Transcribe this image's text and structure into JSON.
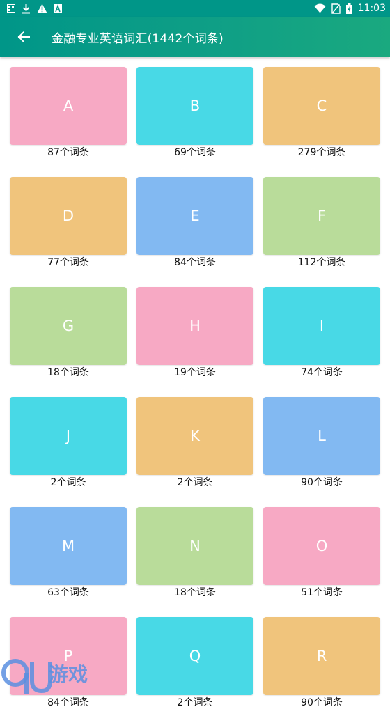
{
  "status_bar": {
    "time": "11:03",
    "left_icons": [
      "gallery-icon",
      "download-icon",
      "warning-icon",
      "a-box-icon"
    ],
    "right_icons": [
      "wifi-icon",
      "no-sim-icon",
      "battery-icon"
    ]
  },
  "header": {
    "title": "金融专业英语词汇(1442个词条)",
    "back_icon": "arrow-left-icon",
    "background": "#009688"
  },
  "palette": {
    "pink": "#F7A9C4",
    "cyan": "#48D9E6",
    "orange": "#F0C47C",
    "blue": "#82B9F2",
    "green": "#B9DC9A"
  },
  "tiles": [
    {
      "letter": "A",
      "count": "87个词条",
      "color": "#F7A9C4"
    },
    {
      "letter": "B",
      "count": "69个词条",
      "color": "#48D9E6"
    },
    {
      "letter": "C",
      "count": "279个词条",
      "color": "#F0C47C"
    },
    {
      "letter": "D",
      "count": "77个词条",
      "color": "#F0C47C"
    },
    {
      "letter": "E",
      "count": "84个词条",
      "color": "#82B9F2"
    },
    {
      "letter": "F",
      "count": "112个词条",
      "color": "#B9DC9A"
    },
    {
      "letter": "G",
      "count": "18个词条",
      "color": "#B9DC9A"
    },
    {
      "letter": "H",
      "count": "19个词条",
      "color": "#F7A9C4"
    },
    {
      "letter": "I",
      "count": "74个词条",
      "color": "#48D9E6"
    },
    {
      "letter": "J",
      "count": "2个词条",
      "color": "#48D9E6"
    },
    {
      "letter": "K",
      "count": "2个词条",
      "color": "#F0C47C"
    },
    {
      "letter": "L",
      "count": "90个词条",
      "color": "#82B9F2"
    },
    {
      "letter": "M",
      "count": "63个词条",
      "color": "#82B9F2"
    },
    {
      "letter": "N",
      "count": "18个词条",
      "color": "#B9DC9A"
    },
    {
      "letter": "O",
      "count": "51个词条",
      "color": "#F7A9C4"
    },
    {
      "letter": "P",
      "count": "84个词条",
      "color": "#F7A9C4"
    },
    {
      "letter": "Q",
      "count": "2个词条",
      "color": "#48D9E6"
    },
    {
      "letter": "R",
      "count": "90个词条",
      "color": "#F0C47C"
    }
  ],
  "watermark": {
    "logo": "9u-logo",
    "text": "9U游戏"
  }
}
